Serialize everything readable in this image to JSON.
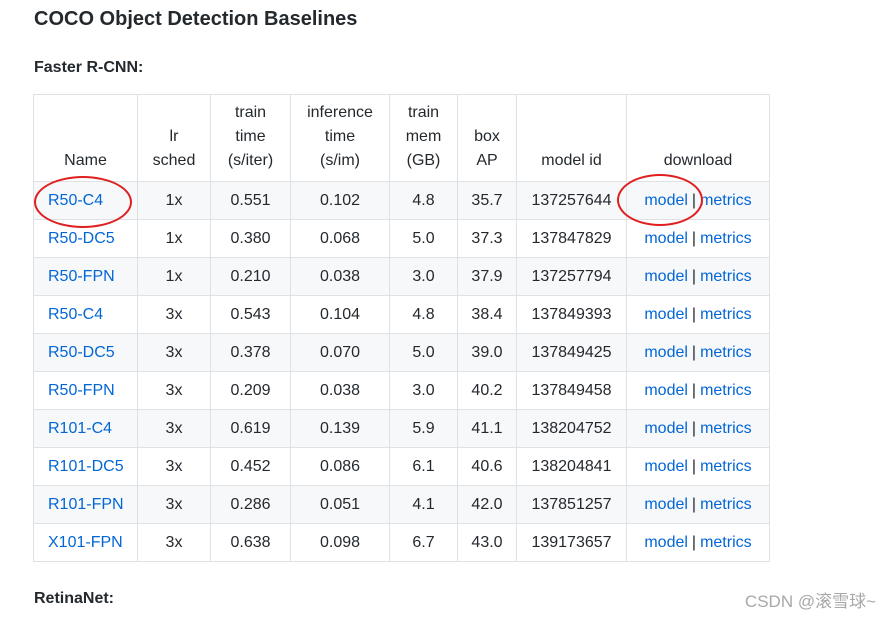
{
  "page_title": "COCO Object Detection Baselines",
  "section_faster": "Faster R-CNN:",
  "section_retina": "RetinaNet:",
  "columns": [
    "Name",
    "lr sched",
    "train time (s/iter)",
    "inference time (s/im)",
    "train mem (GB)",
    "box AP",
    "model id",
    "download"
  ],
  "columns_display": [
    [
      "Name"
    ],
    [
      "lr",
      "sched"
    ],
    [
      "train",
      "time",
      "(s/iter)"
    ],
    [
      "inference",
      "time",
      "(s/im)"
    ],
    [
      "train",
      "mem",
      "(GB)"
    ],
    [
      "box",
      "AP"
    ],
    [
      "model id"
    ],
    [
      "download"
    ]
  ],
  "link_model": "model",
  "link_separator": "|",
  "link_metrics": "metrics",
  "rows": [
    {
      "name": "R50-C4",
      "lr_sched": "1x",
      "train_time": "0.551",
      "inference_time": "0.102",
      "train_mem": "4.8",
      "box_ap": "35.7",
      "model_id": "137257644"
    },
    {
      "name": "R50-DC5",
      "lr_sched": "1x",
      "train_time": "0.380",
      "inference_time": "0.068",
      "train_mem": "5.0",
      "box_ap": "37.3",
      "model_id": "137847829"
    },
    {
      "name": "R50-FPN",
      "lr_sched": "1x",
      "train_time": "0.210",
      "inference_time": "0.038",
      "train_mem": "3.0",
      "box_ap": "37.9",
      "model_id": "137257794"
    },
    {
      "name": "R50-C4",
      "lr_sched": "3x",
      "train_time": "0.543",
      "inference_time": "0.104",
      "train_mem": "4.8",
      "box_ap": "38.4",
      "model_id": "137849393"
    },
    {
      "name": "R50-DC5",
      "lr_sched": "3x",
      "train_time": "0.378",
      "inference_time": "0.070",
      "train_mem": "5.0",
      "box_ap": "39.0",
      "model_id": "137849425"
    },
    {
      "name": "R50-FPN",
      "lr_sched": "3x",
      "train_time": "0.209",
      "inference_time": "0.038",
      "train_mem": "3.0",
      "box_ap": "40.2",
      "model_id": "137849458"
    },
    {
      "name": "R101-C4",
      "lr_sched": "3x",
      "train_time": "0.619",
      "inference_time": "0.139",
      "train_mem": "5.9",
      "box_ap": "41.1",
      "model_id": "138204752"
    },
    {
      "name": "R101-DC5",
      "lr_sched": "3x",
      "train_time": "0.452",
      "inference_time": "0.086",
      "train_mem": "6.1",
      "box_ap": "40.6",
      "model_id": "138204841"
    },
    {
      "name": "R101-FPN",
      "lr_sched": "3x",
      "train_time": "0.286",
      "inference_time": "0.051",
      "train_mem": "4.1",
      "box_ap": "42.0",
      "model_id": "137851257"
    },
    {
      "name": "X101-FPN",
      "lr_sched": "3x",
      "train_time": "0.638",
      "inference_time": "0.098",
      "train_mem": "6.7",
      "box_ap": "43.0",
      "model_id": "139173657"
    }
  ],
  "watermark": "CSDN @滚雪球~",
  "colors": {
    "link": "#0366d6",
    "text": "#24292e",
    "border": "#dfe2e5",
    "stripe": "#f6f8fa",
    "annotation": "#e02020"
  }
}
